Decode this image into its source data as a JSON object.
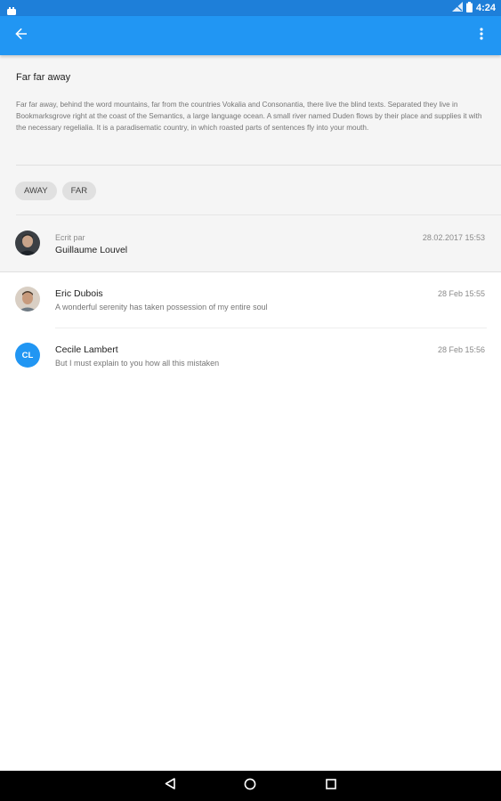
{
  "status_bar": {
    "time": "4:24"
  },
  "app_bar": {
    "back_icon": "arrow-back-icon",
    "menu_icon": "more-vert-icon",
    "color": "#2196f3"
  },
  "post": {
    "title": "Far far away",
    "description": "Far far away, behind the word mountains, far from the countries Vokalia and Consonantia, there live the blind texts. Separated they live in Bookmarksgrove right at the coast of the Semantics, a large language ocean. A small river named Duden flows by their place and supplies it with the necessary regelialia. It is a paradisematic country, in which roasted parts of sentences fly into your mouth.",
    "tags": [
      "AWAY",
      "FAR"
    ],
    "author": {
      "label": "Ecrit par",
      "name": "Guillaume Louvel",
      "date": "28.02.2017 15:53"
    }
  },
  "comments": [
    {
      "name": "Eric Dubois",
      "text": "A wonderful serenity has taken possession of my entire soul",
      "date": "28 Feb 15:55",
      "avatar": "photo"
    },
    {
      "name": "Cecile Lambert",
      "text": "But I must explain to you how all this mistaken",
      "date": "28 Feb 15:56",
      "initials": "CL"
    }
  ],
  "nav_bar": {
    "back_icon": "nav-back-icon",
    "home_icon": "nav-home-icon",
    "recents_icon": "nav-recents-icon"
  }
}
